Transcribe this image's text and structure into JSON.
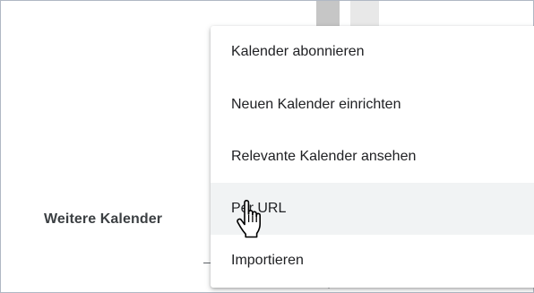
{
  "background": {
    "clipped_header_text": "——————",
    "section_label": "Weitere Kalender"
  },
  "menu": {
    "items": [
      {
        "label": "Kalender abonnieren",
        "hovered": false
      },
      {
        "label": "Neuen Kalender einrichten",
        "hovered": false
      },
      {
        "label": "Relevante Kalender ansehen",
        "hovered": false
      },
      {
        "label": "Per URL",
        "hovered": true
      },
      {
        "label": "Importieren",
        "hovered": false
      }
    ]
  },
  "cursor": {
    "type": "hand-pointer-icon"
  },
  "colors": {
    "text": "#202124",
    "secondary_text": "#3c4043",
    "hover_bg": "#f1f3f4",
    "frame_border": "#b0b8c4"
  }
}
